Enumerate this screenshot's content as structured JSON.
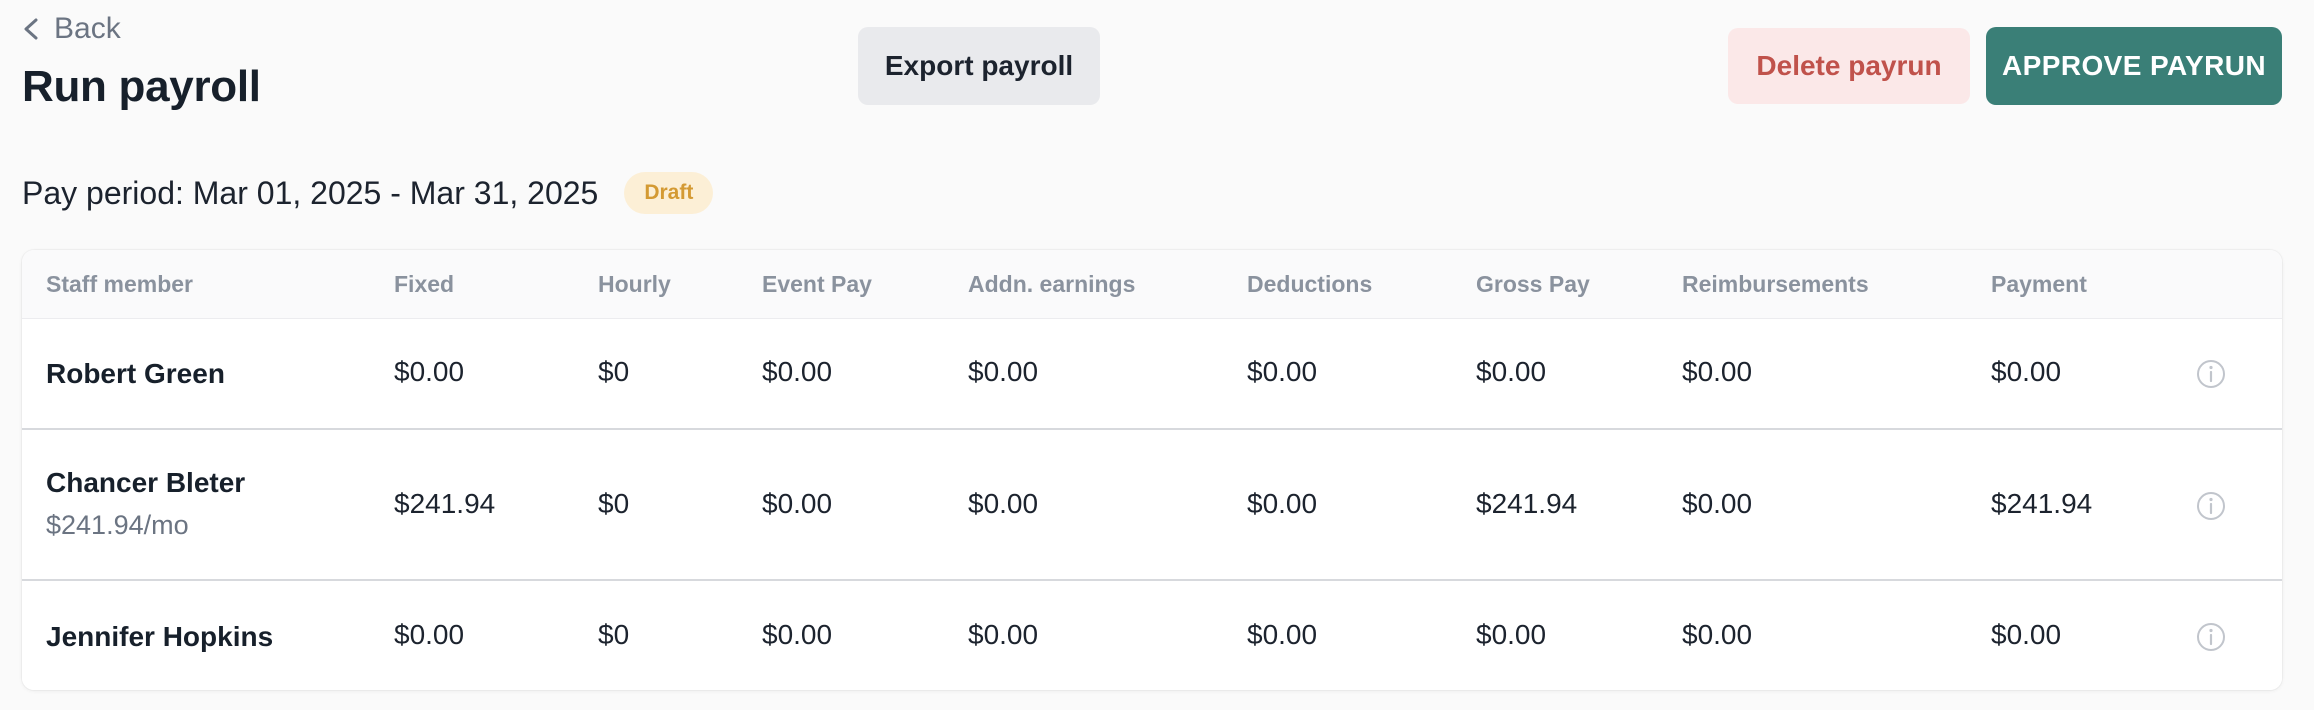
{
  "nav": {
    "back_label": "Back"
  },
  "header": {
    "title": "Run payroll"
  },
  "actions": {
    "export_label": "Export payroll",
    "delete_label": "Delete payrun",
    "approve_label": "APPROVE PAYRUN"
  },
  "period": {
    "text": "Pay period: Mar 01, 2025 - Mar 31, 2025",
    "status": "Draft"
  },
  "table": {
    "columns": [
      "Staff member",
      "Fixed",
      "Hourly",
      "Event Pay",
      "Addn. earnings",
      "Deductions",
      "Gross Pay",
      "Reimbursements",
      "Payment"
    ],
    "rows": [
      {
        "name": "Robert Green",
        "sub": "",
        "fixed": "$0.00",
        "hourly": "$0",
        "event_pay": "$0.00",
        "addn_earnings": "$0.00",
        "deductions": "$0.00",
        "gross_pay": "$0.00",
        "reimbursements": "$0.00",
        "payment": "$0.00"
      },
      {
        "name": "Chancer Bleter",
        "sub": "$241.94/mo",
        "fixed": "$241.94",
        "hourly": "$0",
        "event_pay": "$0.00",
        "addn_earnings": "$0.00",
        "deductions": "$0.00",
        "gross_pay": "$241.94",
        "reimbursements": "$0.00",
        "payment": "$241.94"
      },
      {
        "name": "Jennifer Hopkins",
        "sub": "",
        "fixed": "$0.00",
        "hourly": "$0",
        "event_pay": "$0.00",
        "addn_earnings": "$0.00",
        "deductions": "$0.00",
        "gross_pay": "$0.00",
        "reimbursements": "$0.00",
        "payment": "$0.00"
      }
    ]
  },
  "icons": {
    "back": "chevron-left-icon",
    "row_info": "info-icon"
  },
  "colors": {
    "approve": "#3a7f77",
    "delete_bg": "#fbe8e8",
    "delete_text": "#c0524b",
    "draft_bg": "#fcefd6",
    "draft_text": "#d49a33"
  }
}
